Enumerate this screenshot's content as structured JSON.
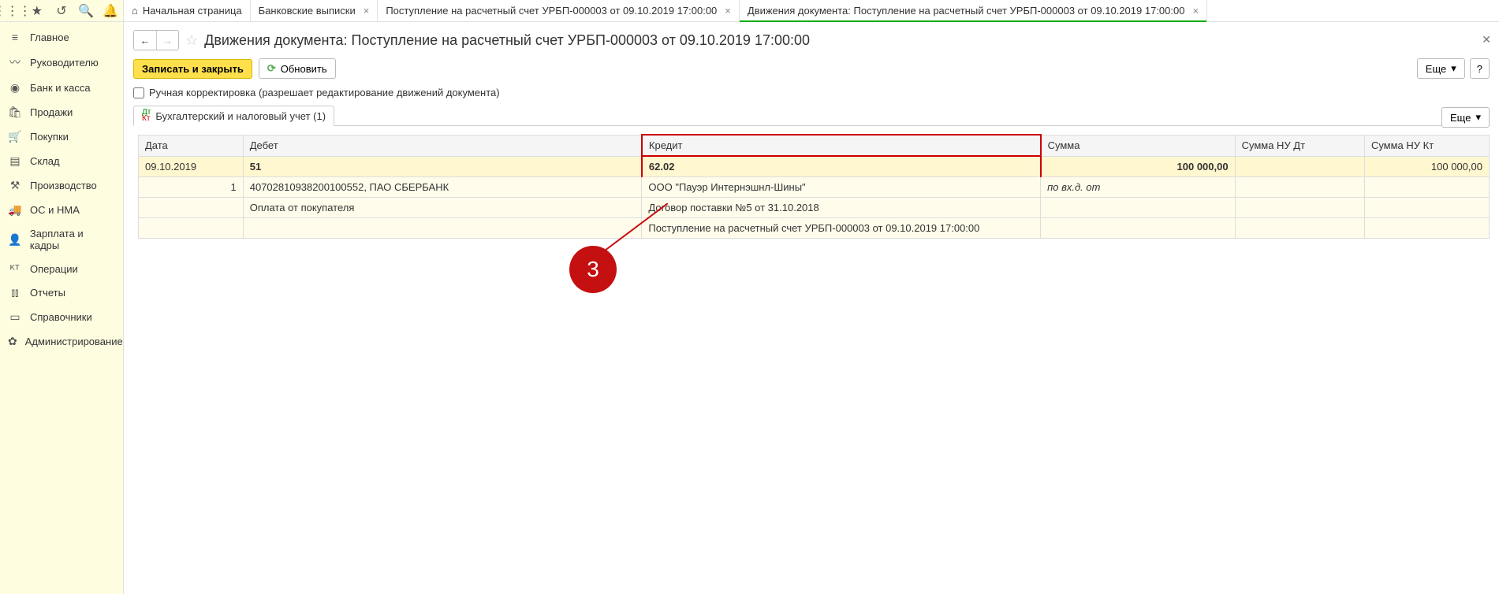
{
  "topIcons": [
    "apps-icon",
    "star-icon",
    "history-icon",
    "search-icon",
    "bell-icon"
  ],
  "tabs": [
    {
      "label": "Начальная страница",
      "home": true,
      "close": false
    },
    {
      "label": "Банковские выписки",
      "close": true
    },
    {
      "label": "Поступление на расчетный счет УРБП-000003 от 09.10.2019 17:00:00",
      "close": true
    },
    {
      "label": "Движения документа: Поступление на расчетный счет УРБП-000003 от 09.10.2019 17:00:00",
      "close": true,
      "active": true
    }
  ],
  "sidebar": [
    {
      "icon": "≡",
      "label": "Главное"
    },
    {
      "icon": "〰",
      "label": "Руководителю"
    },
    {
      "icon": "◉",
      "label": "Банк и касса"
    },
    {
      "icon": "🛍",
      "label": "Продажи"
    },
    {
      "icon": "🛒",
      "label": "Покупки"
    },
    {
      "icon": "▤",
      "label": "Склад"
    },
    {
      "icon": "⚒",
      "label": "Производство"
    },
    {
      "icon": "🚚",
      "label": "ОС и НМА"
    },
    {
      "icon": "👤",
      "label": "Зарплата и кадры"
    },
    {
      "icon": "ᴷᵀ",
      "label": "Операции"
    },
    {
      "icon": "⫾⫾",
      "label": "Отчеты"
    },
    {
      "icon": "▭",
      "label": "Справочники"
    },
    {
      "icon": "✿",
      "label": "Администрирование"
    }
  ],
  "page": {
    "title": "Движения документа: Поступление на расчетный счет УРБП-000003 от 09.10.2019 17:00:00",
    "saveClose": "Записать и закрыть",
    "refresh": "Обновить",
    "more": "Еще",
    "help": "?",
    "manualLabel": "Ручная корректировка (разрешает редактирование движений документа)",
    "tabLabel": "Бухгалтерский и налоговый учет (1)"
  },
  "table": {
    "headers": {
      "date": "Дата",
      "debit": "Дебет",
      "credit": "Кредит",
      "sum": "Сумма",
      "sumNuDt": "Сумма НУ Дт",
      "sumNuKt": "Сумма НУ Кт"
    },
    "row1": {
      "date": "09.10.2019",
      "n": "1",
      "debit": "51",
      "credit": "62.02",
      "sum": "100 000,00",
      "sumNuKt": "100 000,00"
    },
    "sub": {
      "debit1": "40702810938200100552, ПАО СБЕРБАНК",
      "debit2": "Оплата от покупателя",
      "credit1": "ООО \"Пауэр Интернэшнл-Шины\"",
      "credit2": "Договор поставки №5 от 31.10.2018",
      "credit3": "Поступление на расчетный счет УРБП-000003 от 09.10.2019 17:00:00",
      "sumlabel": "по вх.д.  от"
    }
  },
  "callout": "3"
}
